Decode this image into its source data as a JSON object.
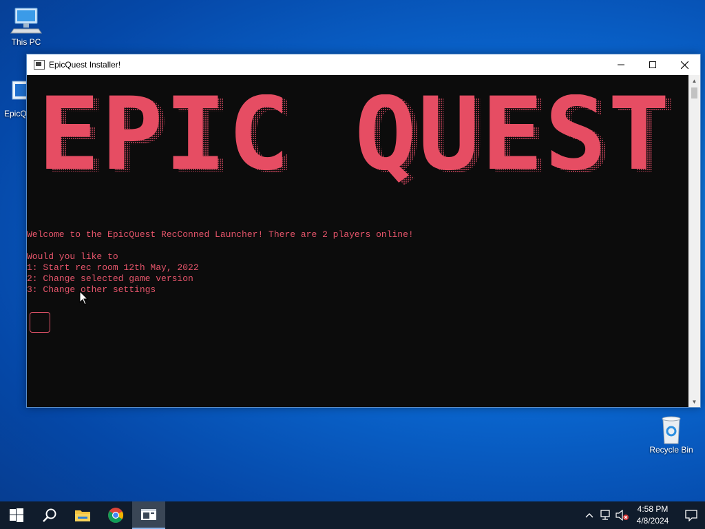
{
  "desktop": {
    "icons": [
      {
        "label": "This PC"
      },
      {
        "label": "EpicQ"
      },
      {
        "label": "Recycle Bin"
      }
    ]
  },
  "window": {
    "title": "EpicQuest Installer!",
    "banner_text": "EPIC QUEST",
    "colors": {
      "text": "#e6556b",
      "background": "#0c0c0c"
    },
    "lines": [
      "Welcome to the EpicQuest RecConned Launcher! There are 2 players online!",
      "",
      "Would you like to",
      "1: Start rec room 12th May, 2022",
      "2: Change selected game version",
      "3: Change other settings"
    ]
  },
  "taskbar": {
    "items": [
      "start-button",
      "search-icon",
      "file-explorer-icon",
      "chrome-icon",
      "console-app-icon"
    ],
    "clock": {
      "time": "4:58 PM",
      "date": "4/8/2024"
    }
  }
}
